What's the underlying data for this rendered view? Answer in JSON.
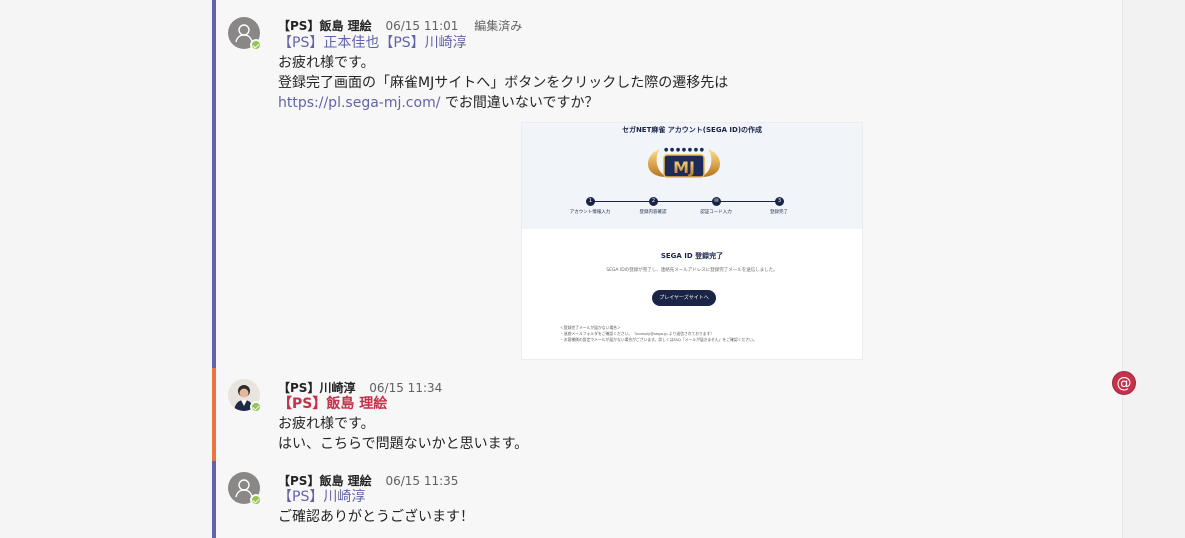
{
  "messages": [
    {
      "author": "【PS】飯島 理絵",
      "time": "06/15 11:01",
      "edited": "編集済み",
      "mentions": [
        "【PS】正本佳也",
        "【PS】川崎淳"
      ],
      "lines": [
        "お疲れ様です。",
        "登録完了画面の「麻雀MJサイトへ」ボタンをクリックした際の遷移先は"
      ],
      "link": "https://pl.sega-mj.com/",
      "after_link": " でお間違いないですか？"
    },
    {
      "author": "【PS】川崎淳",
      "time": "06/15 11:34",
      "mention": "【PS】飯島 理絵",
      "lines": [
        "お疲れ様です。",
        "はい、こちらで問題ないかと思います。"
      ]
    },
    {
      "author": "【PS】飯島 理絵",
      "time": "06/15 11:35",
      "mention": "【PS】川崎淳",
      "lines": [
        "ご確認ありがとうございます！"
      ]
    }
  ],
  "screenshot": {
    "title": "セガNET麻雀 アカウント(SEGA ID)の作成",
    "logo_text": "MJ",
    "steps": [
      {
        "num": "1",
        "label": "アカウント情報入力"
      },
      {
        "num": "2",
        "label": "登録内容確認"
      },
      {
        "num": "✉",
        "label": "認証コード入力"
      },
      {
        "num": "3",
        "label": "登録完了"
      }
    ],
    "done_title": "SEGA ID 登録完了",
    "done_text": "SEGA IDの登録が完了し、連絡先メールアドレスに登録完了メールを送信しました。",
    "button": "プレイヤーズサイトへ",
    "notes": [
      "＜登録完了メールが届かない場合＞",
      "・迷惑メールフォルダをご確認ください。（noreply@sega.jp より送信されております）",
      "・お客様側の設定でメールが届かない場合がございます。詳しくはFAQ「メールが届きません」をご確認ください。"
    ]
  },
  "icons": {
    "at": "@",
    "presence_color": "#92c353"
  },
  "colors": {
    "accent": "#6264a7",
    "mention_highlight": "#c4314b",
    "thread_orange": "#e8763e"
  }
}
